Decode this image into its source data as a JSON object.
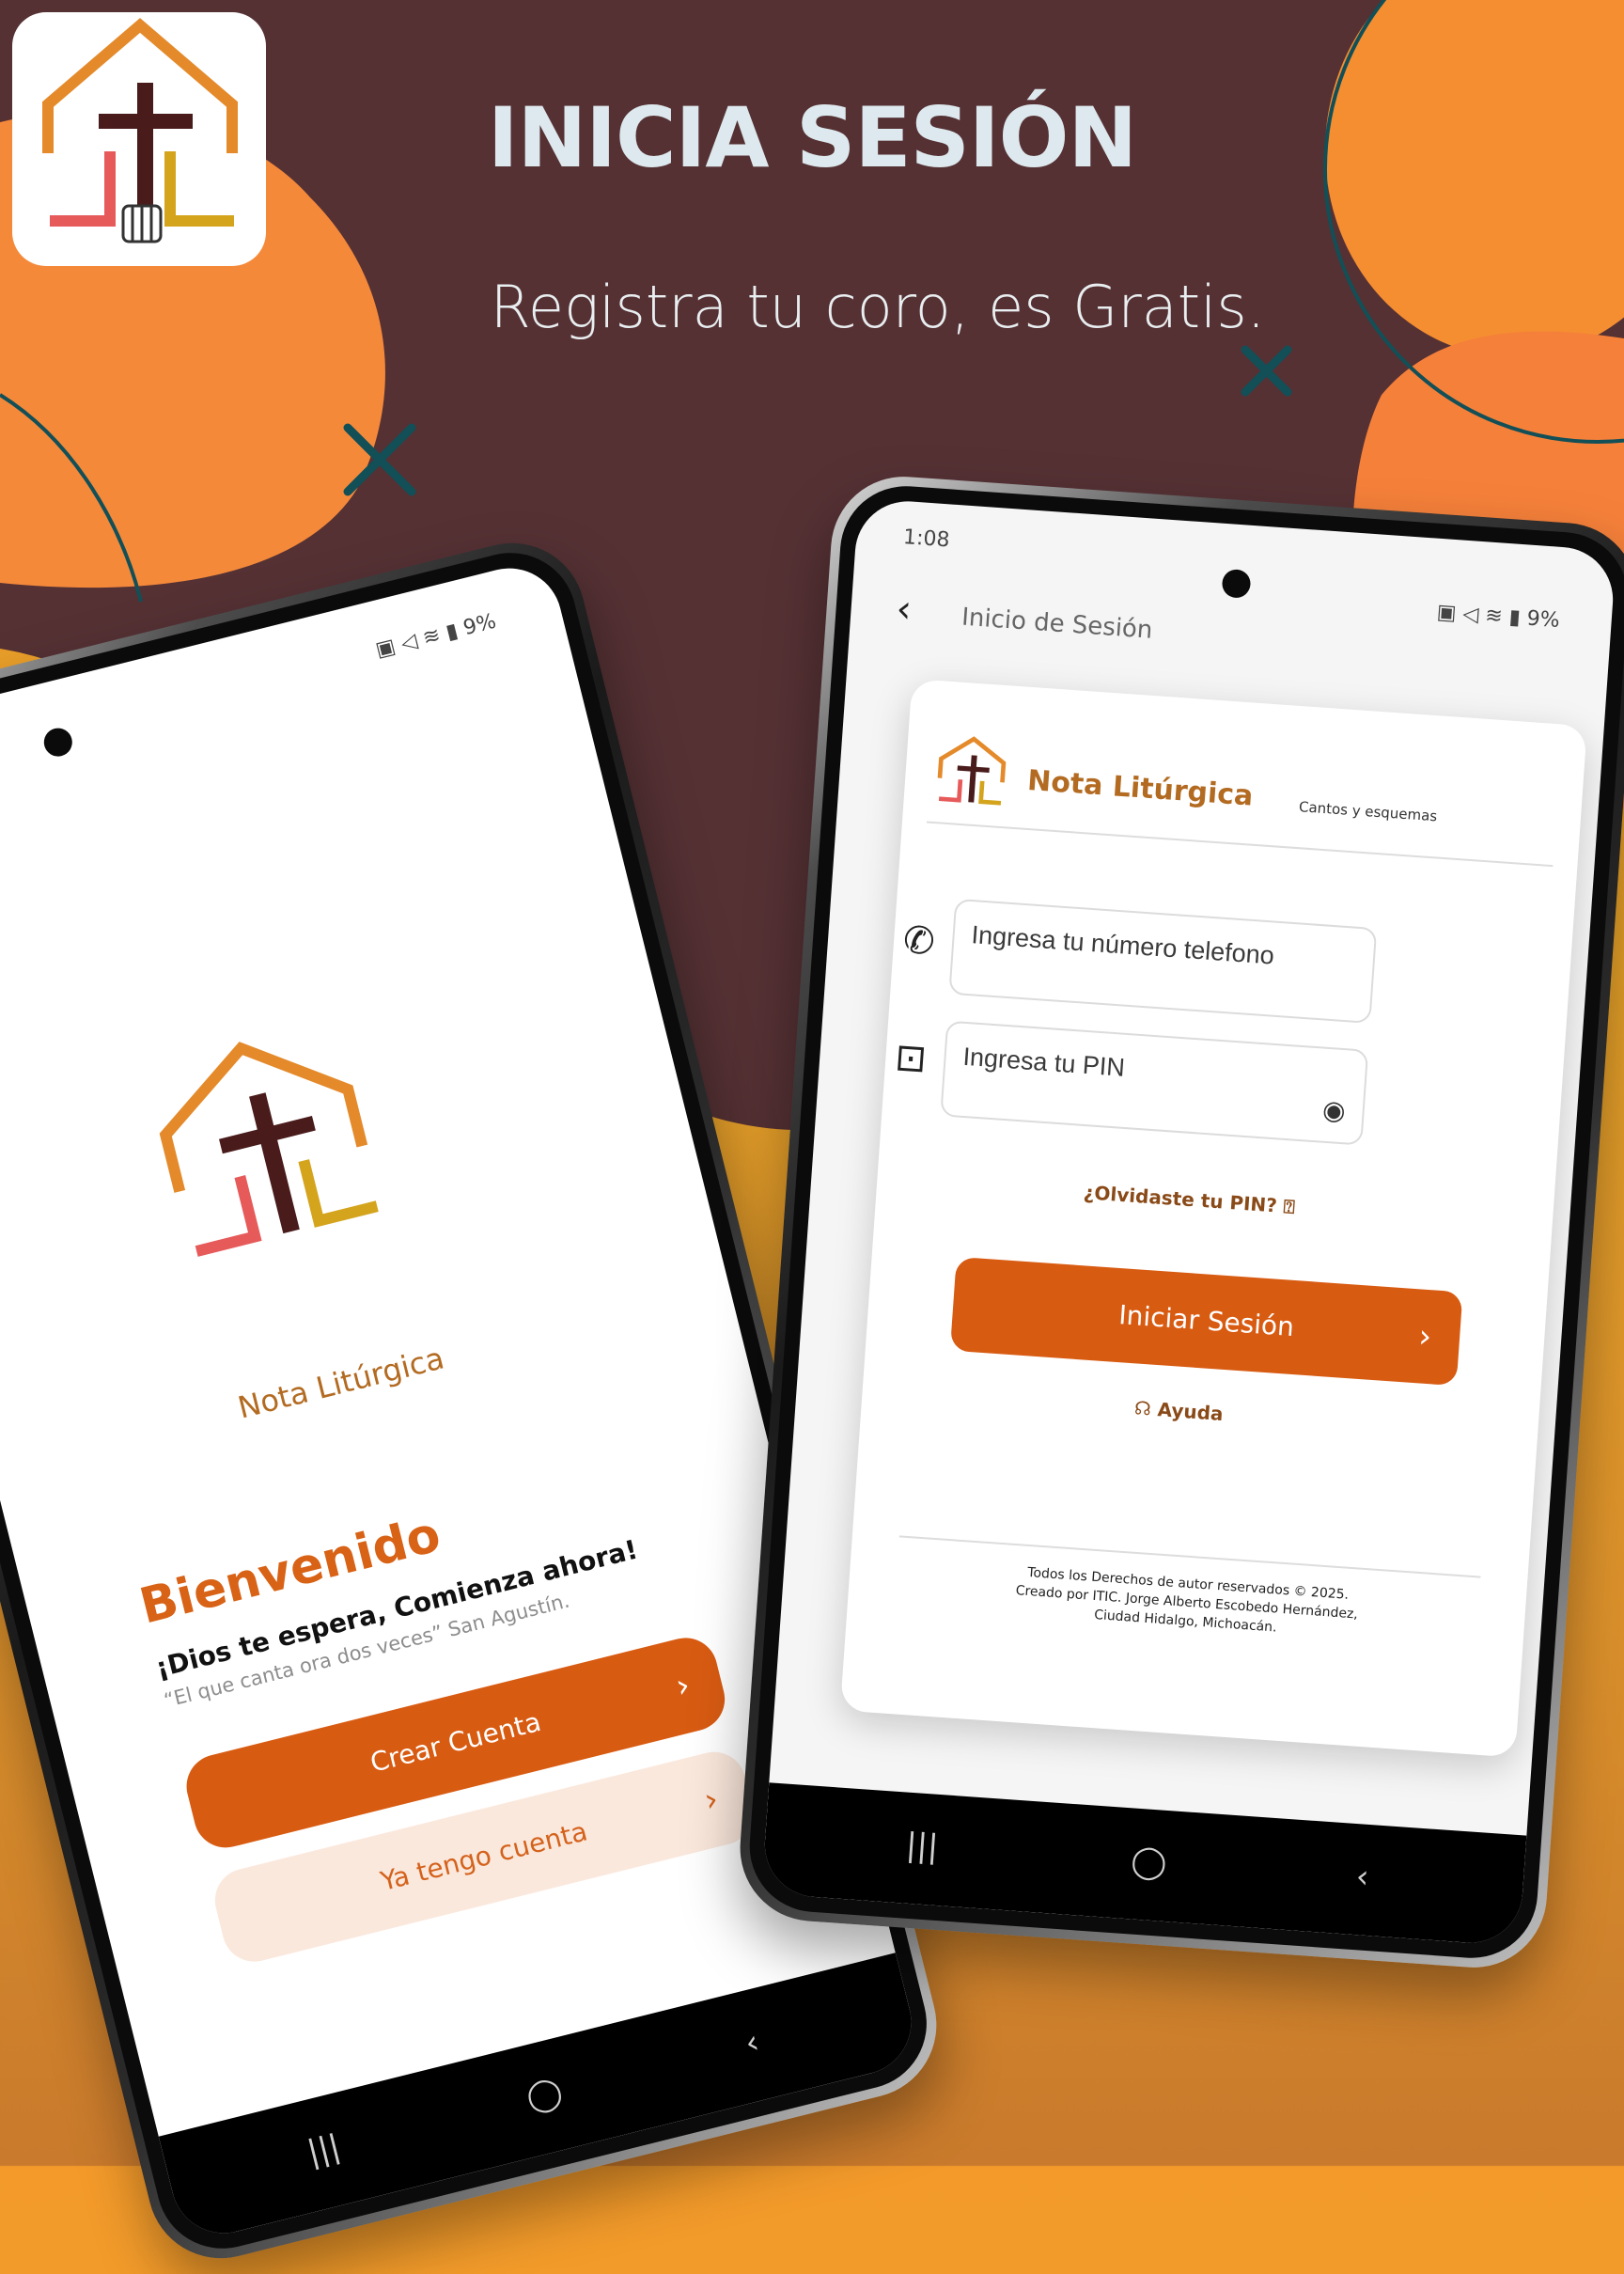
{
  "hero": {
    "title": "INICIA SESIÓN",
    "subtitle": "Registra tu coro, es Gratis."
  },
  "colors": {
    "background_dark": "#553134",
    "accent_orange": "#d85b12",
    "secondary_button_bg": "#fbe8dc",
    "brand_text": "#b36b22",
    "decoration_teal": "#124f57"
  },
  "left_phone": {
    "status_bar": {
      "battery": "9%"
    },
    "brand_name": "Nota Litúrgica",
    "welcome": "Bienvenido",
    "tagline": "¡Dios te espera, Comienza ahora!",
    "quote": "“El que canta ora dos veces” San Agustín.",
    "create_account": "Crear Cuenta",
    "have_account": "Ya tengo cuenta",
    "nav": {
      "recent": "|||",
      "home": "◯",
      "back": "‹"
    }
  },
  "right_phone": {
    "status_bar": {
      "time": "1:08",
      "battery": "9%"
    },
    "header_title": "Inicio de Sesión",
    "brand_name": "Nota Litúrgica",
    "brand_tagline": "Cantos y esquemas",
    "phone_placeholder": "Ingresa tu número telefono",
    "pin_placeholder": "Ingresa tu PIN",
    "forgot_pin": "¿Olvidaste tu PIN?",
    "login_button": "Iniciar Sesión",
    "help": "Ayuda",
    "footer": {
      "line1": "Todos los Derechos de autor reservados © 2025.",
      "line2": "Creado por ITIC. Jorge Alberto Escobedo Hernández,",
      "line3": "Ciudad Hidalgo, Michoacán."
    },
    "nav": {
      "recent": "|||",
      "home": "◯",
      "back": "‹"
    }
  }
}
